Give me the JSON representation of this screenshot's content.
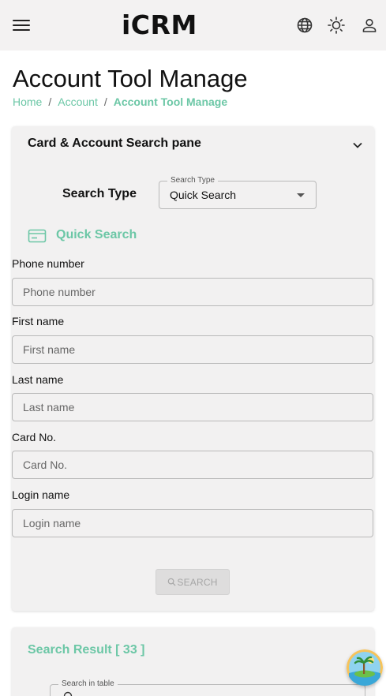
{
  "app": {
    "title": "iCRM"
  },
  "header_icons": [
    "menu-icon",
    "globe-icon",
    "sun-icon",
    "user-icon"
  ],
  "page": {
    "title": "Account Tool Manage",
    "breadcrumb": [
      "Home",
      "Account",
      "Account Tool Manage"
    ]
  },
  "search_pane": {
    "title": "Card & Account Search pane",
    "search_type_label": "Search Type",
    "select": {
      "legend": "Search Type",
      "value": "Quick Search"
    },
    "section_title": "Quick Search",
    "fields": [
      {
        "label": "Phone number",
        "placeholder": "Phone number",
        "value": ""
      },
      {
        "label": "First name",
        "placeholder": "First name",
        "value": ""
      },
      {
        "label": "Last name",
        "placeholder": "Last name",
        "value": ""
      },
      {
        "label": "Card No.",
        "placeholder": "Card No.",
        "value": ""
      },
      {
        "label": "Login name",
        "placeholder": "Login name",
        "value": ""
      }
    ],
    "search_button": "SEARCH"
  },
  "result": {
    "title": "Search Result [ 33 ]",
    "table_search_legend": "Search in table"
  },
  "colors": {
    "accent": "#6cc7a6",
    "appbar_bg": "#f3f2f2",
    "card_bg": "#f2f1f1",
    "disabled_button_bg": "#dedddd"
  }
}
